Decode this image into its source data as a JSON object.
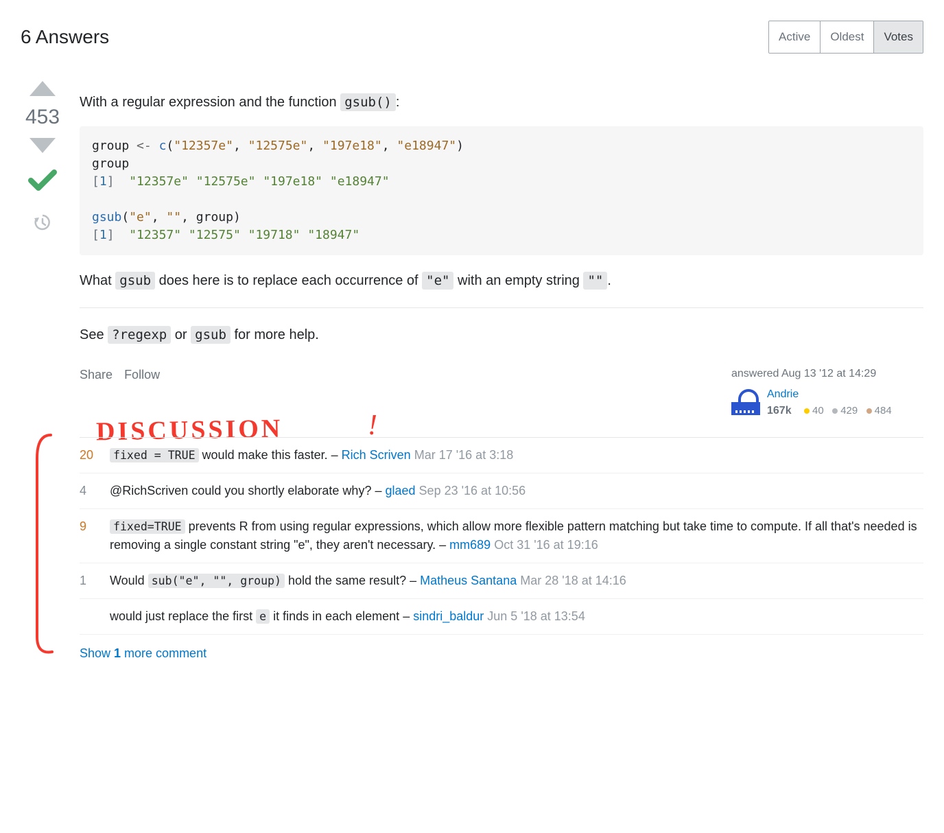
{
  "header": {
    "title": "6 Answers",
    "sort_tabs": [
      "Active",
      "Oldest",
      "Votes"
    ],
    "active_sort": "Votes"
  },
  "answer": {
    "score": "453",
    "intro_prefix": "With a regular expression and the function ",
    "intro_code": "gsub()",
    "intro_suffix": ":",
    "explain_prefix": "What ",
    "explain_code1": "gsub",
    "explain_mid1": " does here is to replace each occurrence of ",
    "explain_code2": "\"e\"",
    "explain_mid2": " with an empty string ",
    "explain_code3": "\"\"",
    "explain_suffix": ".",
    "see_prefix": "See ",
    "see_code1": "?regexp",
    "see_mid": " or ",
    "see_code2": "gsub",
    "see_suffix": " for more help.",
    "share_label": "Share",
    "follow_label": "Follow",
    "answered_label": "answered Aug 13 '12 at 14:29",
    "user": {
      "name": "Andrie",
      "rep": "167k",
      "gold": "40",
      "silver": "429",
      "bronze": "484"
    },
    "code": {
      "l1_a": "group ",
      "l1_op": "<-",
      "l1_b": " ",
      "l1_fn": "c",
      "l1_open": "(",
      "l1_s1": "\"12357e\"",
      "l1_s2": "\"12575e\"",
      "l1_s3": "\"197e18\"",
      "l1_s4": "\"e18947\"",
      "l1_close": ")",
      "l2": "group",
      "l3_idx": "[1]",
      "l3_pad": "  ",
      "l3_s1": "\"12357e\"",
      "l3_s2": "\"12575e\"",
      "l3_s3": "\"197e18\"",
      "l3_s4": "\"e18947\"",
      "l5_fn": "gsub",
      "l5_open": "(",
      "l5_s1": "\"e\"",
      "l5_s2": "\"\"",
      "l5_var": "group",
      "l5_close": ")",
      "l6_idx": "[1]",
      "l6_pad": "  ",
      "l6_s1": "\"12357\"",
      "l6_s2": "\"12575\"",
      "l6_s3": "\"19718\"",
      "l6_s4": "\"18947\""
    }
  },
  "annotation": {
    "text": "DISCUSSION",
    "mark": "!"
  },
  "comments": [
    {
      "score": "20",
      "warm": true,
      "pre_code": "fixed = TRUE",
      "text_after": " would make this faster.",
      "user": "Rich Scriven",
      "time": "Mar 17 '16 at 3:18"
    },
    {
      "score": "4",
      "warm": false,
      "text_plain": "@RichScriven could you shortly elaborate why?",
      "user": "glaed",
      "time": "Sep 23 '16 at 10:56"
    },
    {
      "score": "9",
      "warm": true,
      "pre_code": "fixed=TRUE",
      "text_after": " prevents R from using regular expressions, which allow more flexible pattern matching but take time to compute. If all that's needed is removing a single constant string \"e\", they aren't necessary.",
      "user": "mm689",
      "time": "Oct 31 '16 at 19:16"
    },
    {
      "score": "1",
      "warm": false,
      "text_before": "Would ",
      "pre_code": "sub(\"e\", \"\", group)",
      "text_after": " hold the same result?",
      "user": "Matheus Santana",
      "time": "Mar 28 '18 at 14:16"
    },
    {
      "score": "",
      "warm": false,
      "text_before": "would just replace the first ",
      "pre_code": "e",
      "text_after": " it finds in each element",
      "user": "sindri_baldur",
      "time": "Jun 5 '18 at 13:54"
    }
  ],
  "show_more": {
    "prefix": "Show ",
    "count": "1",
    "suffix": " more comment"
  }
}
